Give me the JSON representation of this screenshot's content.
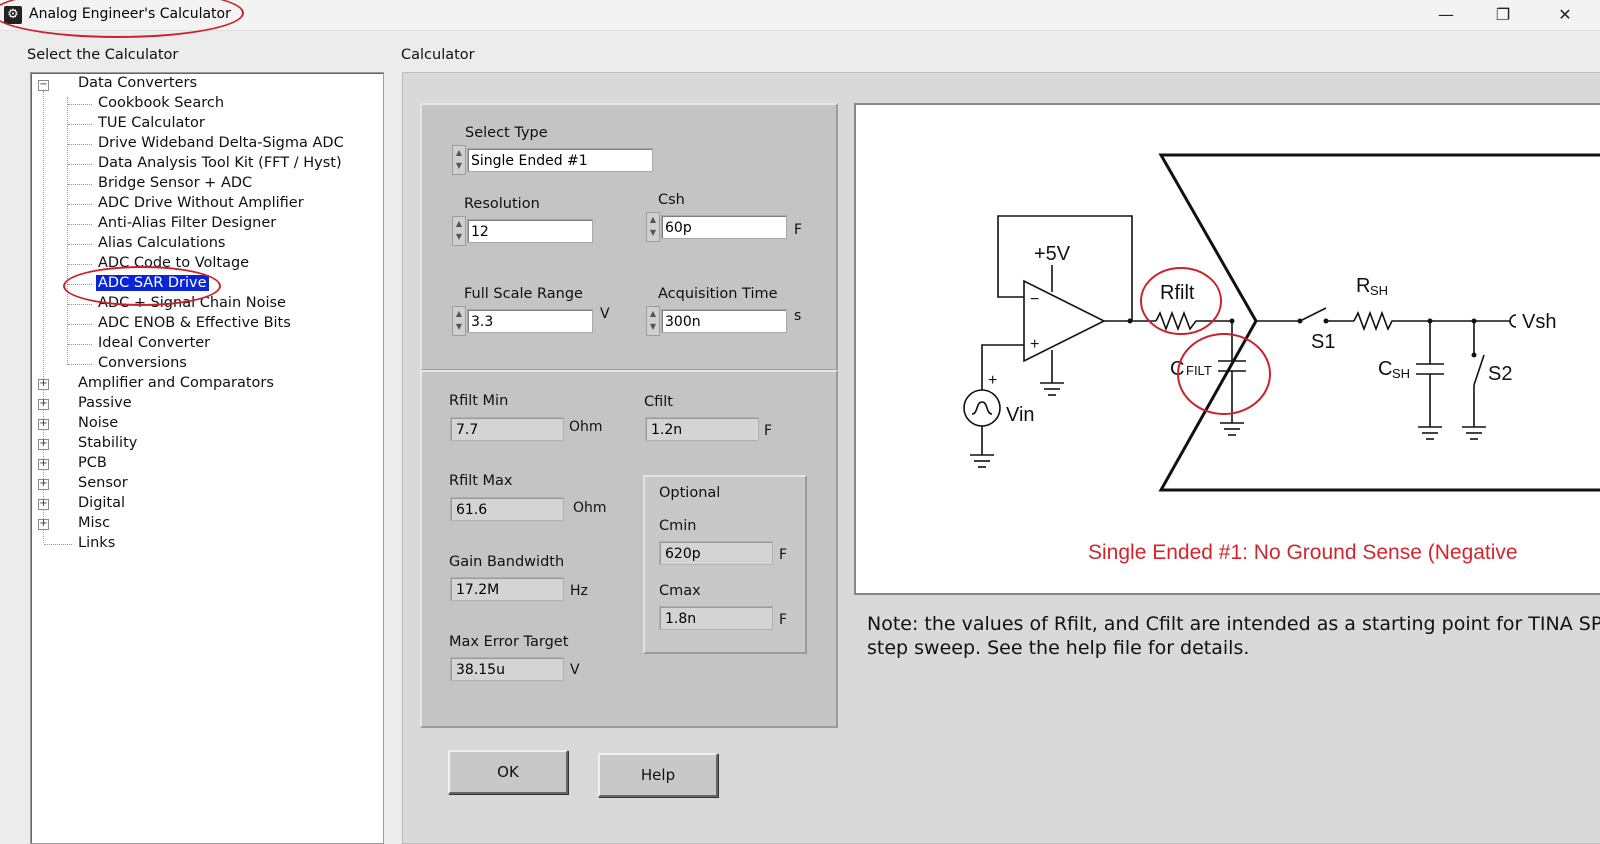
{
  "window": {
    "title": "Analog Engineer's Calculator",
    "minimize": "—",
    "maximize": "❐",
    "close": "✕"
  },
  "left_header": "Select the Calculator",
  "right_header": "Calculator",
  "tree": {
    "data_converters": "Data Converters",
    "children": [
      "Cookbook Search",
      "TUE Calculator",
      "Drive Wideband Delta-Sigma ADC",
      "Data Analysis Tool Kit (FFT / Hyst)",
      "Bridge Sensor + ADC",
      "ADC Drive Without Amplifier",
      "Anti-Alias Filter Designer",
      "Alias Calculations",
      "ADC Code to Voltage",
      "ADC SAR Drive",
      "ADC + Signal Chain Noise",
      "ADC ENOB & Effective Bits",
      "Ideal Converter",
      "Conversions"
    ],
    "selected": "ADC SAR Drive",
    "categories": [
      "Amplifier and Comparators",
      "Passive",
      "Noise",
      "Stability",
      "PCB",
      "Sensor",
      "Digital",
      "Misc"
    ],
    "links": "Links",
    "expand_symbol": "+",
    "collapse_symbol": "−"
  },
  "inputs": {
    "select_type": {
      "label": "Select Type",
      "value": "Single Ended #1"
    },
    "resolution": {
      "label": "Resolution",
      "value": "12"
    },
    "csh": {
      "label": "Csh",
      "value": "60p",
      "unit": "F"
    },
    "full_scale_range": {
      "label": "Full Scale Range",
      "value": "3.3",
      "unit": "V"
    },
    "acquisition_time": {
      "label": "Acquisition Time",
      "value": "300n",
      "unit": "s"
    }
  },
  "outputs": {
    "rfilt_min": {
      "label": "Rfilt Min",
      "value": "7.7",
      "unit": "Ohm"
    },
    "cfilt": {
      "label": "Cfilt",
      "value": "1.2n",
      "unit": "F"
    },
    "rfilt_max": {
      "label": "Rfilt Max",
      "value": "61.6",
      "unit": "Ohm"
    },
    "gain_bandwidth": {
      "label": "Gain Bandwidth",
      "value": "17.2M",
      "unit": "Hz"
    },
    "max_error_target": {
      "label": "Max Error Target",
      "value": "38.15u",
      "unit": "V"
    }
  },
  "optional": {
    "title": "Optional",
    "cmin": {
      "label": "Cmin",
      "value": "620p",
      "unit": "F"
    },
    "cmax": {
      "label": "Cmax",
      "value": "1.8n",
      "unit": "F"
    }
  },
  "buttons": {
    "ok": "OK",
    "help": "Help"
  },
  "schematic": {
    "supply": "+5V",
    "vin": "Vin",
    "rfilt": "Rfilt",
    "cfilt_c": "C",
    "cfilt_sub": "FILT",
    "rsh_r": "R",
    "rsh_sub": "SH",
    "csh_c": "C",
    "csh_sub": "SH",
    "s1": "S1",
    "s2": "S2",
    "vsh": "Vsh",
    "plus": "+",
    "minus": "−",
    "caption": "Single Ended #1: No Ground Sense (Negative"
  },
  "note": {
    "line1": "Note: the values of Rfilt, and Cfilt are intended as a starting point for TINA SPIC",
    "line2": "step sweep.  See the help file for details."
  },
  "colors": {
    "selection": "#0a24d8",
    "annotation": "#c8222a",
    "caption": "#d1262d"
  }
}
